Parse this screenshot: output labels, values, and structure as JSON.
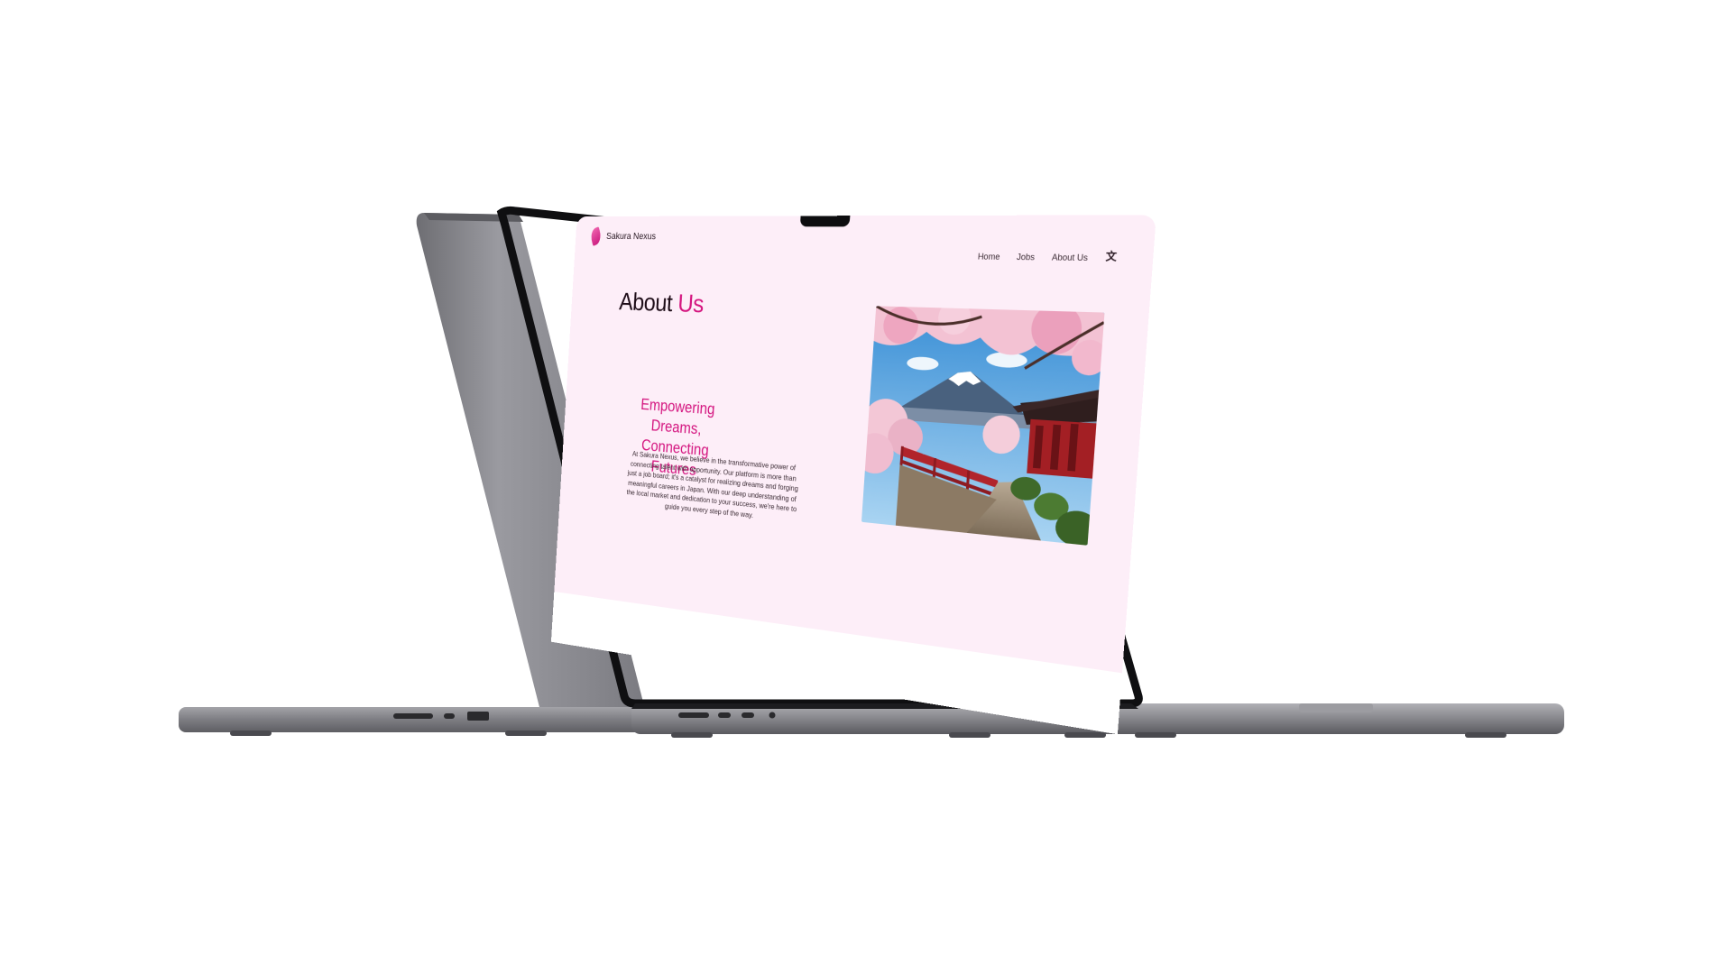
{
  "brand": {
    "name": "Sakura Nexus",
    "accent_color": "#d4157f",
    "background_color": "#fdeef8"
  },
  "nav": {
    "items": [
      {
        "label": "Home"
      },
      {
        "label": "Jobs"
      },
      {
        "label": "About Us"
      }
    ],
    "translate_icon": "translate-icon"
  },
  "page": {
    "title_part1": "About",
    "title_part2": "Us"
  },
  "hero": {
    "heading": "Empowering Dreams, Connecting Futures",
    "body": "At Sakura Nexus, we believe in the transformative power of connecting talent with opportunity. Our platform is more than just a job board; it's a catalyst for realizing dreams and forging meaningful careers in Japan. With our deep understanding of the local market and dedication to your success, we're here to guide you every step of the way.",
    "image_subject": "mount-fuji-cherry-blossom-temple"
  },
  "device": {
    "model": "laptop-mockup",
    "color": "#8e8e93"
  }
}
